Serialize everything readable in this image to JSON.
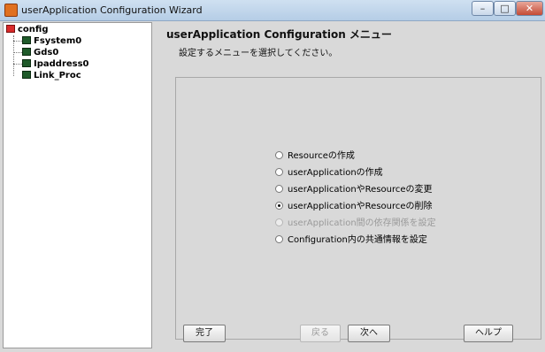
{
  "window": {
    "title": "userApplication Configuration Wizard",
    "buttons": {
      "minimize": "–",
      "maximize": "□",
      "close": "✕"
    }
  },
  "tree": {
    "root": {
      "label": "config",
      "icon": "config-icon"
    },
    "children": [
      {
        "label": "Fsystem0",
        "icon": "resource-icon"
      },
      {
        "label": "Gds0",
        "icon": "resource-icon"
      },
      {
        "label": "Ipaddress0",
        "icon": "resource-icon"
      },
      {
        "label": "Link_Proc",
        "icon": "resource-icon"
      }
    ]
  },
  "main": {
    "title": "userApplication Configuration メニュー",
    "subtitle": "設定するメニューを選択してください。",
    "options": [
      {
        "label": "Resourceの作成",
        "checked": false,
        "enabled": true
      },
      {
        "label": "userApplicationの作成",
        "checked": false,
        "enabled": true
      },
      {
        "label": "userApplicationやResourceの変更",
        "checked": false,
        "enabled": true
      },
      {
        "label": "userApplicationやResourceの削除",
        "checked": true,
        "enabled": true
      },
      {
        "label": "userApplication間の依存関係を設定",
        "checked": false,
        "enabled": false
      },
      {
        "label": "Configuration内の共通情報を設定",
        "checked": false,
        "enabled": true
      }
    ]
  },
  "buttons": {
    "finish": "完了",
    "back": "戻る",
    "next": "次へ",
    "help": "ヘルプ"
  }
}
